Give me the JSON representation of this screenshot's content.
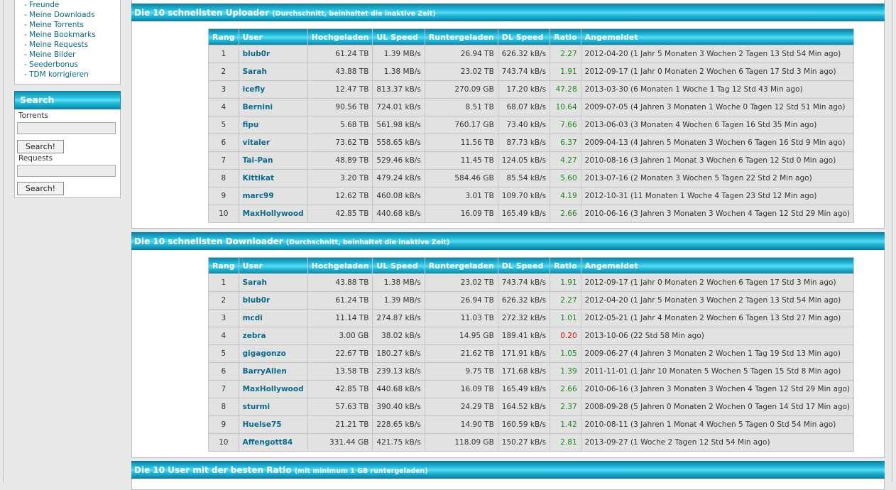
{
  "sidebar": {
    "menu_items": [
      "- Freunde",
      "- Meine Downloads",
      "- Meine Torrents",
      "- Meine Bookmarks",
      "- Meine Requests",
      "- Meine Bilder",
      "- Seederbonus",
      "- TDM korrigieren"
    ],
    "search": {
      "title": "Search",
      "torrents_label": "Torrents",
      "requests_label": "Requests",
      "button_label": "Search!"
    }
  },
  "columns": [
    "Rang",
    "User",
    "Hochgeladen",
    "UL Speed",
    "Runtergeladen",
    "DL Speed",
    "Ratio",
    "Angemeldet"
  ],
  "sections": [
    {
      "title": "Die 10 schnellsten Uploader",
      "subtitle": "(Durchschnitt, beinhaltet die inaktive Zeit)",
      "rows": [
        {
          "rank": "1",
          "user": "blub0r",
          "up": "61.24 TB",
          "uls": "1.39 MB/s",
          "down": "26.94 TB",
          "dls": "626.32 kB/s",
          "ratio": "2.27",
          "date": "2012-04-20 (1 Jahr 5 Monaten 3 Wochen 2 Tagen 13 Std 54 Min ago)"
        },
        {
          "rank": "2",
          "user": "Sarah",
          "up": "43.88 TB",
          "uls": "1.38 MB/s",
          "down": "23.02 TB",
          "dls": "743.74 kB/s",
          "ratio": "1.91",
          "date": "2012-09-17 (1 Jahr 0 Monaten 2 Wochen 6 Tagen 17 Std 3 Min ago)"
        },
        {
          "rank": "3",
          "user": "icefly",
          "up": "12.47 TB",
          "uls": "813.37 kB/s",
          "down": "270.09 GB",
          "dls": "17.20 kB/s",
          "ratio": "47.28",
          "date": "2013-03-30 (6 Monaten 1 Woche 1 Tag 12 Std 43 Min ago)"
        },
        {
          "rank": "4",
          "user": "Bernini",
          "up": "90.56 TB",
          "uls": "724.01 kB/s",
          "down": "8.51 TB",
          "dls": "68.07 kB/s",
          "ratio": "10.64",
          "date": "2009-07-05 (4 Jahren 3 Monaten 1 Woche 0 Tagen 12 Std 51 Min ago)"
        },
        {
          "rank": "5",
          "user": "fipu",
          "up": "5.68 TB",
          "uls": "561.98 kB/s",
          "down": "760.17 GB",
          "dls": "73.40 kB/s",
          "ratio": "7.66",
          "date": "2013-06-03 (3 Monaten 4 Wochen 6 Tagen 16 Std 35 Min ago)"
        },
        {
          "rank": "6",
          "user": "vitaler",
          "up": "73.62 TB",
          "uls": "558.65 kB/s",
          "down": "11.56 TB",
          "dls": "87.73 kB/s",
          "ratio": "6.37",
          "date": "2009-04-13 (4 Jahren 5 Monaten 3 Wochen 6 Tagen 16 Std 9 Min ago)"
        },
        {
          "rank": "7",
          "user": "Tai-Pan",
          "up": "48.89 TB",
          "uls": "529.46 kB/s",
          "down": "11.45 TB",
          "dls": "124.05 kB/s",
          "ratio": "4.27",
          "date": "2010-08-16 (3 Jahren 1 Monat 3 Wochen 6 Tagen 12 Std 0 Min ago)"
        },
        {
          "rank": "8",
          "user": "Kittikat",
          "up": "3.20 TB",
          "uls": "479.24 kB/s",
          "down": "584.46 GB",
          "dls": "85.54 kB/s",
          "ratio": "5.60",
          "date": "2013-07-16 (2 Monaten 3 Wochen 5 Tagen 22 Std 2 Min ago)"
        },
        {
          "rank": "9",
          "user": "marc99",
          "up": "12.62 TB",
          "uls": "460.08 kB/s",
          "down": "3.01 TB",
          "dls": "109.70 kB/s",
          "ratio": "4.19",
          "date": "2012-10-31 (11 Monaten 1 Woche 4 Tagen 23 Std 12 Min ago)"
        },
        {
          "rank": "10",
          "user": "MaxHollywood",
          "up": "42.85 TB",
          "uls": "440.68 kB/s",
          "down": "16.09 TB",
          "dls": "165.49 kB/s",
          "ratio": "2.66",
          "date": "2010-06-16 (3 Jahren 3 Monaten 3 Wochen 4 Tagen 12 Std 29 Min ago)"
        }
      ]
    },
    {
      "title": "Die 10 schnellsten Downloader",
      "subtitle": "(Durchschnitt, beinhaltet die inaktive Zeit)",
      "rows": [
        {
          "rank": "1",
          "user": "Sarah",
          "up": "43.88 TB",
          "uls": "1.38 MB/s",
          "down": "23.02 TB",
          "dls": "743.74 kB/s",
          "ratio": "1.91",
          "date": "2012-09-17 (1 Jahr 0 Monaten 2 Wochen 6 Tagen 17 Std 3 Min ago)"
        },
        {
          "rank": "2",
          "user": "blub0r",
          "up": "61.24 TB",
          "uls": "1.39 MB/s",
          "down": "26.94 TB",
          "dls": "626.32 kB/s",
          "ratio": "2.27",
          "date": "2012-04-20 (1 Jahr 5 Monaten 3 Wochen 2 Tagen 13 Std 54 Min ago)"
        },
        {
          "rank": "3",
          "user": "mcdi",
          "up": "11.14 TB",
          "uls": "274.87 kB/s",
          "down": "11.03 TB",
          "dls": "272.32 kB/s",
          "ratio": "1.01",
          "date": "2012-05-21 (1 Jahr 4 Monaten 2 Wochen 6 Tagen 13 Std 27 Min ago)"
        },
        {
          "rank": "4",
          "user": "zebra",
          "up": "3.00 GB",
          "uls": "38.02 kB/s",
          "down": "14.95 GB",
          "dls": "189.41 kB/s",
          "ratio": "0.20",
          "date": "2013-10-06 (22 Std 58 Min ago)"
        },
        {
          "rank": "5",
          "user": "gigagonzo",
          "up": "22.67 TB",
          "uls": "180.27 kB/s",
          "down": "21.62 TB",
          "dls": "171.91 kB/s",
          "ratio": "1.05",
          "date": "2009-06-27 (4 Jahren 3 Monaten 2 Wochen 1 Tag 19 Std 13 Min ago)"
        },
        {
          "rank": "6",
          "user": "BarryAllen",
          "up": "13.58 TB",
          "uls": "239.13 kB/s",
          "down": "9.75 TB",
          "dls": "171.68 kB/s",
          "ratio": "1.39",
          "date": "2011-11-01 (1 Jahr 10 Monaten 5 Wochen 5 Tagen 15 Std 8 Min ago)"
        },
        {
          "rank": "7",
          "user": "MaxHollywood",
          "up": "42.85 TB",
          "uls": "440.68 kB/s",
          "down": "16.09 TB",
          "dls": "165.49 kB/s",
          "ratio": "2.66",
          "date": "2010-06-16 (3 Jahren 3 Monaten 3 Wochen 4 Tagen 12 Std 29 Min ago)"
        },
        {
          "rank": "8",
          "user": "sturmi",
          "up": "57.63 TB",
          "uls": "390.40 kB/s",
          "down": "24.29 TB",
          "dls": "164.52 kB/s",
          "ratio": "2.37",
          "date": "2008-09-28 (5 Jahren 0 Monaten 2 Wochen 0 Tagen 14 Std 17 Min ago)"
        },
        {
          "rank": "9",
          "user": "Huelse75",
          "up": "21.21 TB",
          "uls": "228.65 kB/s",
          "down": "14.90 TB",
          "dls": "160.59 kB/s",
          "ratio": "1.42",
          "date": "2010-08-11 (3 Jahren 1 Monat 4 Wochen 5 Tagen 0 Std 54 Min ago)"
        },
        {
          "rank": "10",
          "user": "Affengott84",
          "up": "331.44 GB",
          "uls": "421.75 kB/s",
          "down": "118.09 GB",
          "dls": "150.27 kB/s",
          "ratio": "2.81",
          "date": "2013-09-27 (1 Woche 2 Tagen 12 Std 54 Min ago)"
        }
      ]
    },
    {
      "title": "Die 10 User mit der besten Ratio",
      "subtitle": "(mit minimum 1 GB runtergeladen)",
      "rows": []
    }
  ],
  "colors": {
    "accent": "#1fb6d8",
    "link": "#0a6a8c",
    "ratio_good": "#1a8a1a",
    "ratio_bad": "#d01010"
  }
}
